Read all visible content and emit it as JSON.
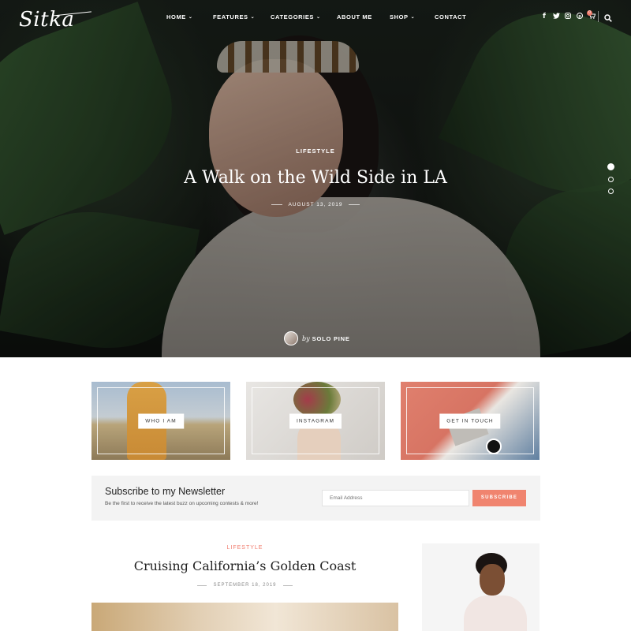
{
  "brand": {
    "logo": "Sitka",
    "accent": "#f0796a"
  },
  "nav": {
    "items": [
      {
        "label": "HOME",
        "dropdown": true
      },
      {
        "label": "FEATURES",
        "dropdown": true
      },
      {
        "label": "CATEGORIES",
        "dropdown": true
      },
      {
        "label": "ABOUT ME",
        "dropdown": false
      },
      {
        "label": "SHOP",
        "dropdown": true
      },
      {
        "label": "CONTACT",
        "dropdown": false
      }
    ],
    "social_icons": [
      "facebook-icon",
      "twitter-icon",
      "instagram-icon",
      "pinterest-icon",
      "cart-icon"
    ],
    "cart_count": "0"
  },
  "hero": {
    "category": "LIFESTYLE",
    "title": "A Walk on the Wild Side in LA",
    "date": "AUGUST 13, 2019",
    "author_prefix": "by",
    "author": "SOLO PINE",
    "slides": 3,
    "active_slide": 1
  },
  "promos": [
    {
      "label": "WHO I AM"
    },
    {
      "label": "INSTAGRAM"
    },
    {
      "label": "GET IN TOUCH"
    }
  ],
  "newsletter": {
    "title": "Subscribe to my Newsletter",
    "subtitle": "Be the first to receive the latest buzz on upcoming contests & more!",
    "placeholder": "Email Address",
    "button": "SUBSCRIBE"
  },
  "post": {
    "category": "LIFESTYLE",
    "title": "Cruising California’s Golden Coast",
    "date": "SEPTEMBER 18, 2019"
  }
}
